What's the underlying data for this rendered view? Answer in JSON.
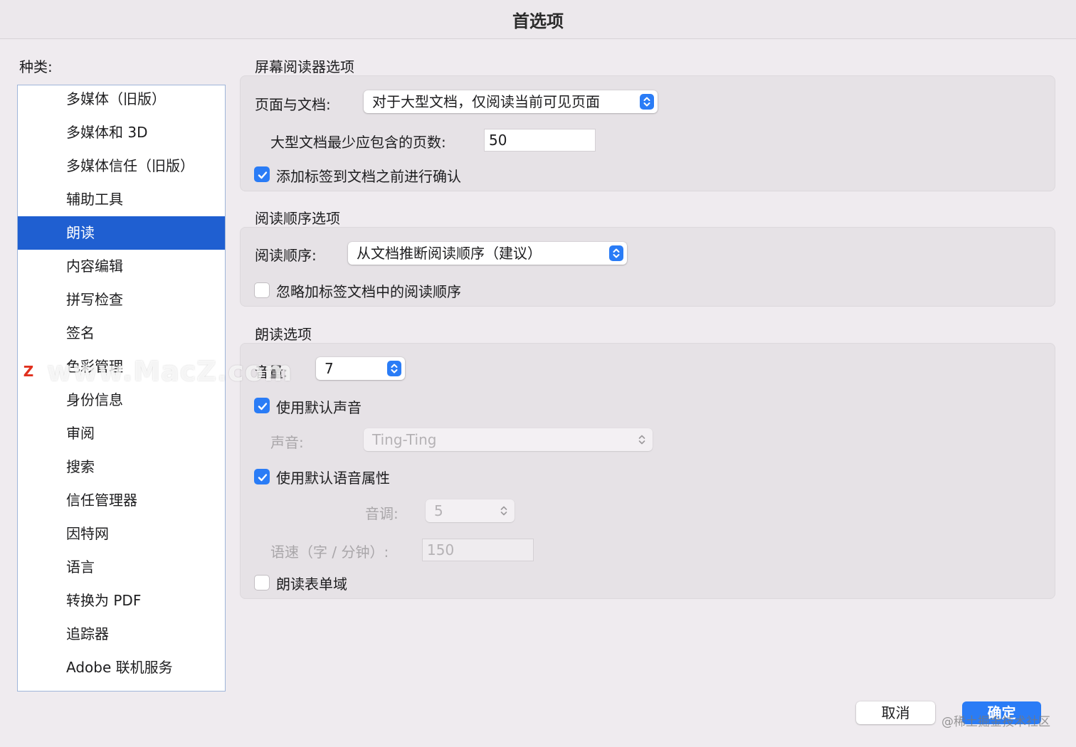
{
  "window": {
    "title": "首选项"
  },
  "sidebar": {
    "label": "种类:",
    "items": [
      {
        "label": "多媒体（旧版）"
      },
      {
        "label": "多媒体和 3D"
      },
      {
        "label": "多媒体信任（旧版）"
      },
      {
        "label": "辅助工具"
      },
      {
        "label": "朗读",
        "selected": true
      },
      {
        "label": "内容编辑"
      },
      {
        "label": "拼写检查"
      },
      {
        "label": "签名"
      },
      {
        "label": "色彩管理"
      },
      {
        "label": "身份信息"
      },
      {
        "label": "审阅"
      },
      {
        "label": "搜索"
      },
      {
        "label": "信任管理器"
      },
      {
        "label": "因特网"
      },
      {
        "label": "语言"
      },
      {
        "label": "转换为 PDF"
      },
      {
        "label": "追踪器"
      },
      {
        "label": "Adobe 联机服务"
      }
    ]
  },
  "screen_reader": {
    "heading": "屏幕阅读器选项",
    "pages_label": "页面与文档:",
    "pages_value": "对于大型文档，仅阅读当前可见页面",
    "min_pages_label": "大型文档最少应包含的页数:",
    "min_pages_value": "50",
    "confirm_tag_label": "添加标签到文档之前进行确认",
    "confirm_tag_checked": true
  },
  "reading_order": {
    "heading": "阅读顺序选项",
    "order_label": "阅读顺序:",
    "order_value": "从文档推断阅读顺序（建议）",
    "ignore_label": "忽略加标签文档中的阅读顺序",
    "ignore_checked": false
  },
  "read_aloud": {
    "heading": "朗读选项",
    "volume_label": "音量:",
    "volume_value": "7",
    "default_voice_label": "使用默认声音",
    "default_voice_checked": true,
    "voice_label": "声音:",
    "voice_value": "Ting-Ting",
    "default_speech_label": "使用默认语音属性",
    "default_speech_checked": true,
    "pitch_label": "音调:",
    "pitch_value": "5",
    "rate_label": "语速（字 / 分钟）:",
    "rate_value": "150",
    "form_fields_label": "朗读表单域",
    "form_fields_checked": false
  },
  "buttons": {
    "cancel": "取消",
    "ok": "确定"
  },
  "watermarks": {
    "macz": "www.MacZ.com",
    "juejin": "@稀土掘金技术社区"
  },
  "colors": {
    "accent": "#2a7cf6",
    "selection": "#1f5fd1",
    "background": "#efebef"
  }
}
